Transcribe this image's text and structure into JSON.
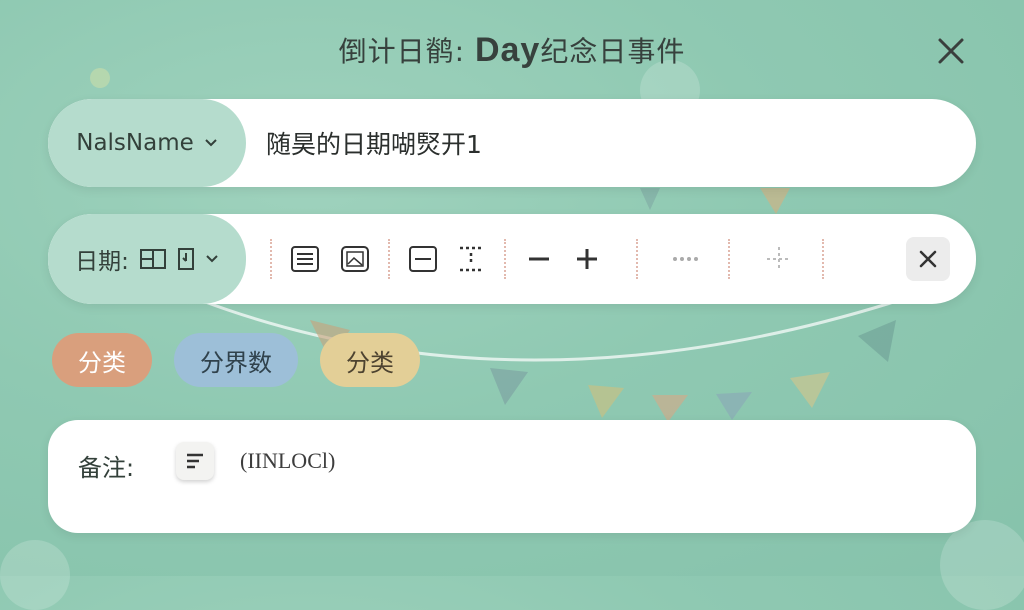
{
  "header": {
    "title_prefix": "倒计日鹡: ",
    "title_big": "Day",
    "title_suffix": "纪念日事件"
  },
  "name_row": {
    "selector_label": "NalsName",
    "value": "随昊的日期㗅㷂开1"
  },
  "date_row": {
    "label": "日期:",
    "icons": [
      "calendar-icon",
      "flag-icon",
      "chevron-down-icon"
    ],
    "toolbar_icons": [
      "list-icon",
      "image-icon",
      "minus-box-icon",
      "grid-dots-icon",
      "minus-icon",
      "plus-icon",
      "ellipsis-icon",
      "move-icon",
      "close-icon"
    ]
  },
  "tags": [
    "分类",
    "分界数",
    "分类"
  ],
  "colors": {
    "bg": "#8fc9b2",
    "tag_orange": "#d99f7d",
    "tag_blue": "#9dbfd8",
    "tag_beige": "#e3cf97",
    "pill": "#b5dccd"
  },
  "note": {
    "label": "备注:",
    "value": "(IINLOCl)"
  }
}
